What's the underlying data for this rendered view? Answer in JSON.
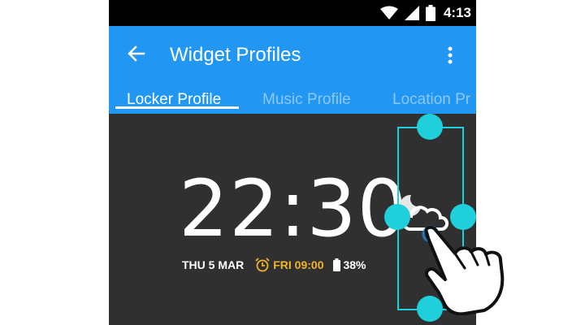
{
  "status_bar": {
    "time": "4:13",
    "icons": [
      "wifi-icon",
      "signal-icon",
      "battery-icon"
    ]
  },
  "app_bar": {
    "title": "Widget Profiles",
    "back_icon": "arrow-back-icon",
    "menu_icon": "overflow-menu-icon"
  },
  "tabs": [
    {
      "label": "Locker Profile",
      "active": true
    },
    {
      "label": "Music Profile",
      "active": false
    },
    {
      "label": "Location Pr",
      "active": false
    }
  ],
  "widget": {
    "time": "22:30",
    "date": "THU 5 MAR",
    "alarm": "FRI 09:00",
    "battery": "38%",
    "weather_icon": "cloudy-night-weather-icon"
  },
  "colors": {
    "app_bar": "#2196F3",
    "background": "#303030",
    "handle": "#1fd0dc",
    "alarm": "#f0b429",
    "tab_inactive": "#8cc9f8"
  },
  "gesture_icon": "pointing-hand-icon"
}
